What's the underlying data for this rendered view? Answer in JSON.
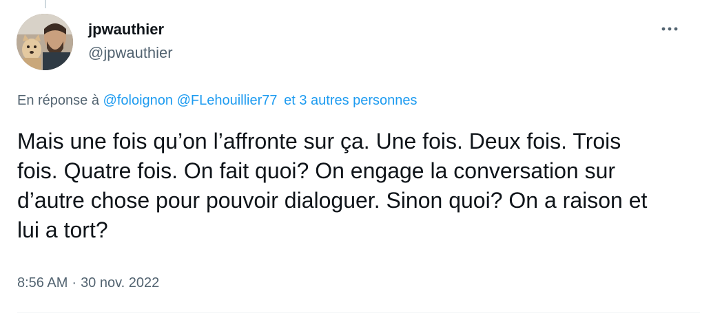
{
  "author": {
    "display_name": "jpwauthier",
    "handle": "@jpwauthier"
  },
  "reply_context": {
    "prefix": "En réponse à",
    "mentions": [
      "@foloignon",
      "@FLehouillier77"
    ],
    "others": "et 3 autres personnes"
  },
  "tweet": {
    "text": "Mais une fois qu’on l’affronte sur ça. Une fois. Deux fois. Trois fois. Quatre fois. On fait quoi? On engage la conversation sur d’autre chose pour pouvoir dialoguer. Sinon quoi? On a raison et lui a tort?",
    "time": "8:56 AM",
    "separator": "·",
    "date": "30 nov. 2022"
  },
  "icons": {
    "more": "more-horizontal-icon"
  },
  "colors": {
    "link": "#1d9bf0",
    "secondary_text": "#536471",
    "primary_text": "#0f1419"
  }
}
